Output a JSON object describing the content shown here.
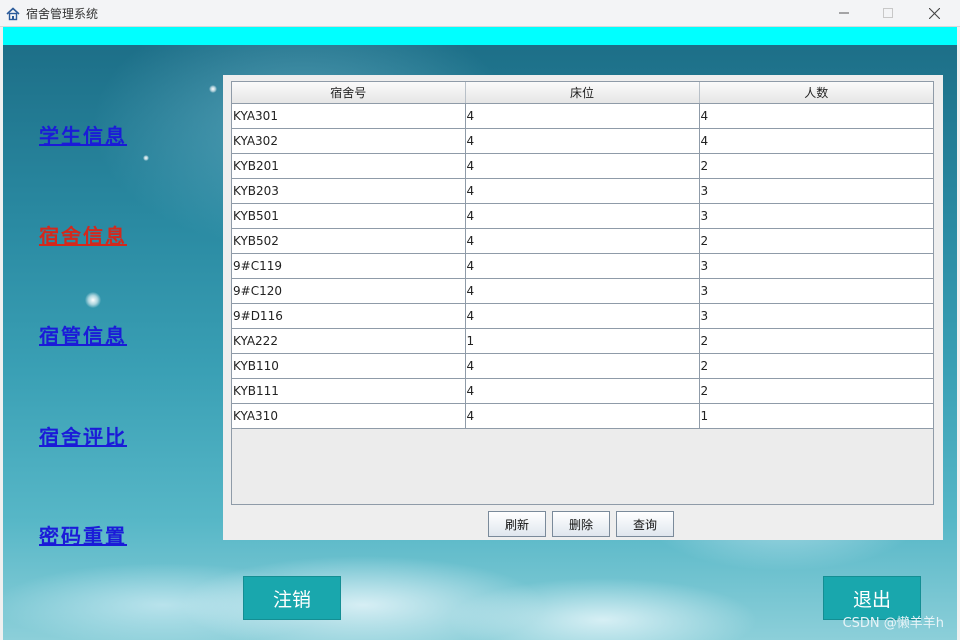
{
  "window": {
    "title": "宿舍管理系统"
  },
  "nav": [
    {
      "label": "学生信息",
      "active": false
    },
    {
      "label": "宿舍信息",
      "active": true
    },
    {
      "label": "宿管信息",
      "active": false
    },
    {
      "label": "宿舍评比",
      "active": false
    },
    {
      "label": "密码重置",
      "active": false
    }
  ],
  "table": {
    "columns": [
      "宿舍号",
      "床位",
      "人数"
    ],
    "rows": [
      [
        "KYA301",
        "4",
        "4"
      ],
      [
        "KYA302",
        "4",
        "4"
      ],
      [
        "KYB201",
        "4",
        "2"
      ],
      [
        "KYB203",
        "4",
        "3"
      ],
      [
        "KYB501",
        "4",
        "3"
      ],
      [
        "KYB502",
        "4",
        "2"
      ],
      [
        "9#C119",
        "4",
        "3"
      ],
      [
        "9#C120",
        "4",
        "3"
      ],
      [
        "9#D116",
        "4",
        "3"
      ],
      [
        "KYA222",
        "1",
        "2"
      ],
      [
        "KYB110",
        "4",
        "2"
      ],
      [
        "KYB111",
        "4",
        "2"
      ],
      [
        "KYA310",
        "4",
        "1"
      ]
    ]
  },
  "buttons": {
    "refresh": "刷新",
    "delete": "删除",
    "query": "查询"
  },
  "actions": {
    "logout": "注销",
    "exit": "退出"
  },
  "watermark": "CSDN @懒羊羊h",
  "colors": {
    "accent_bar": "#00ffff",
    "nav_link": "#1b1bd8",
    "nav_active": "#d4281c",
    "action_button": "#19a7ad"
  }
}
